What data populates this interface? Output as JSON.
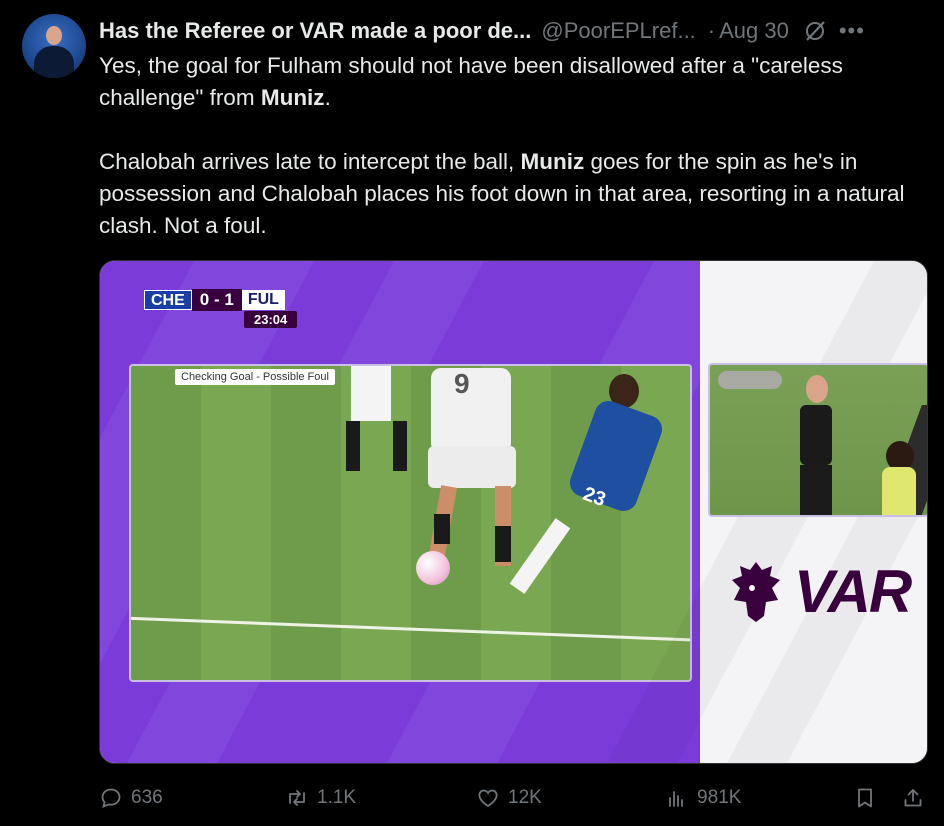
{
  "tweet": {
    "author": {
      "display_name": "Has the Referee or VAR made a poor de...",
      "handle": "@PoorEPLref...",
      "separator": "·",
      "date": "Aug 30"
    },
    "text": {
      "p1_a": "Yes, the goal for Fulham should not have been disallowed after a \"careless challenge\" from ",
      "p1_bold": "Muniz",
      "p1_b": ".",
      "p2_a": "Chalobah arrives late to intercept the ball, ",
      "p2_bold": "Muniz",
      "p2_b": " goes for the spin as he's in possession and Chalobah places his foot down in that area, resorting in a natural clash. Not a foul."
    },
    "media": {
      "scorebug": {
        "home": "CHE",
        "score": "0 - 1",
        "away": "FUL",
        "time": "23:04"
      },
      "checking_label": "Checking Goal - Possible Foul",
      "white_shirt_number": "9",
      "blue_shirt_number": "23",
      "var_text": "VAR"
    },
    "actions": {
      "replies": "636",
      "reposts": "1.1K",
      "likes": "12K",
      "views": "981K"
    }
  },
  "colors": {
    "background": "#000000",
    "text_primary": "#e7e9ea",
    "text_secondary": "#71767b",
    "var_purple": "#7a3bd9",
    "pl_dark_purple": "#38003c"
  },
  "icons": [
    "grok-icon",
    "more-icon",
    "reply-icon",
    "repost-icon",
    "like-icon",
    "views-icon",
    "bookmark-icon",
    "share-icon",
    "premier-league-lion-icon"
  ]
}
